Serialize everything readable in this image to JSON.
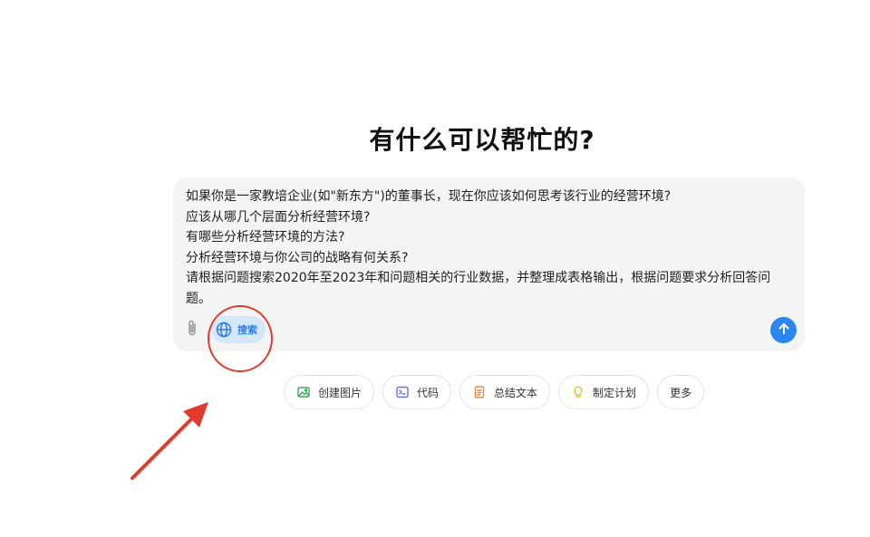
{
  "heading": "有什么可以帮忙的?",
  "composer": {
    "lines": [
      "如果你是一家教培企业(如\"新东方\")的董事长，现在你应该如何思考该行业的经营环境?",
      "应该从哪几个层面分析经营环境?",
      "有哪些分析经营环境的方法?",
      "分析经营环境与你公司的战略有何关系?",
      "请根据问题搜索2020年至2023年和问题相关的行业数据，并整理成表格输出，根据问题要求分析回答问题。"
    ],
    "search_label": "搜索",
    "attach_icon": "paperclip-icon",
    "search_icon": "globe-icon",
    "send_icon": "arrow-up-icon"
  },
  "suggestions": [
    {
      "label": "创建图片",
      "icon": "image-icon",
      "color": "#3aa757"
    },
    {
      "label": "代码",
      "icon": "code-icon",
      "color": "#6d6fd8"
    },
    {
      "label": "总结文本",
      "icon": "document-icon",
      "color": "#e08a3c"
    },
    {
      "label": "制定计划",
      "icon": "lightbulb-icon",
      "color": "#e8c233"
    },
    {
      "label": "更多",
      "icon": "",
      "color": ""
    }
  ],
  "colors": {
    "accent": "#2b86f0",
    "annotation": "#e23a2c",
    "composer_bg": "#f4f4f4"
  }
}
